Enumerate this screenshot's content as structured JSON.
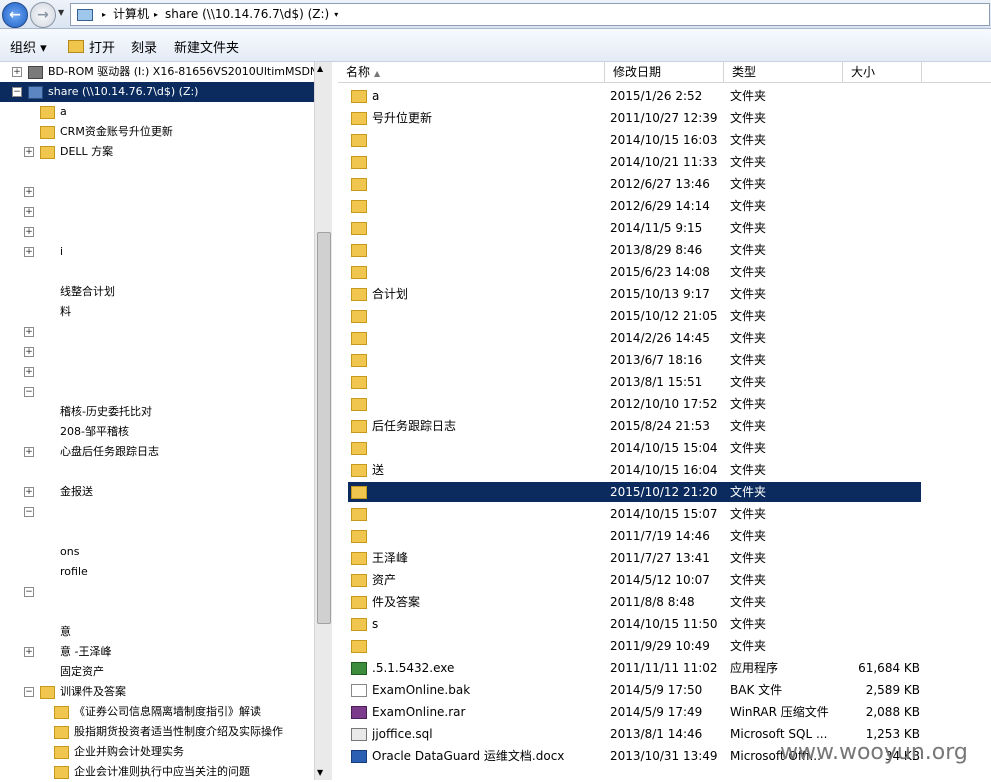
{
  "address": {
    "segments": [
      "计算机",
      "share (\\\\10.14.76.7\\d$) (Z:)"
    ]
  },
  "toolbar": {
    "organize": "组织 ▾",
    "open": "打开",
    "burn": "刻录",
    "new_folder": "新建文件夹"
  },
  "tree": [
    {
      "label": "BD-ROM 驱动器 (I:) X16-81656VS2010UltimMSDNCl",
      "expander": "+",
      "icon": "drive-icon"
    },
    {
      "label": "share (\\\\10.14.76.7\\d$) (Z:)",
      "expander": "-",
      "icon": "network-drive-icon",
      "selected": true
    },
    {
      "label": "a",
      "expander": "",
      "icon": "folder-icon"
    },
    {
      "label": "CRM资金账号升位更新",
      "expander": "",
      "icon": "folder-icon"
    },
    {
      "label": "DELL 方案",
      "expander": "+",
      "icon": "folder-icon"
    },
    {
      "label": "",
      "expander": "",
      "icon": ""
    },
    {
      "label": "",
      "expander": "+",
      "icon": ""
    },
    {
      "label": "",
      "expander": "+",
      "icon": ""
    },
    {
      "label": "",
      "expander": "+",
      "icon": ""
    },
    {
      "label": "i",
      "expander": "+",
      "icon": ""
    },
    {
      "label": "",
      "expander": "",
      "icon": ""
    },
    {
      "label": "线整合计划",
      "expander": "",
      "icon": ""
    },
    {
      "label": "料",
      "expander": "",
      "icon": ""
    },
    {
      "label": "",
      "expander": "+",
      "icon": ""
    },
    {
      "label": "",
      "expander": "+",
      "icon": ""
    },
    {
      "label": "",
      "expander": "+",
      "icon": ""
    },
    {
      "label": "",
      "expander": "-",
      "icon": ""
    },
    {
      "label": "稽核-历史委托比对",
      "expander": "",
      "icon": ""
    },
    {
      "label": "208-邹平稽核",
      "expander": "",
      "icon": ""
    },
    {
      "label": "心盘后任务跟踪日志",
      "expander": "+",
      "icon": ""
    },
    {
      "label": "",
      "expander": "",
      "icon": ""
    },
    {
      "label": "金报送",
      "expander": "+",
      "icon": ""
    },
    {
      "label": "",
      "expander": "-",
      "icon": ""
    },
    {
      "label": "",
      "expander": "",
      "icon": ""
    },
    {
      "label": "ons",
      "expander": "",
      "icon": ""
    },
    {
      "label": "rofile",
      "expander": "",
      "icon": ""
    },
    {
      "label": "",
      "expander": "-",
      "icon": ""
    },
    {
      "label": "",
      "expander": "",
      "icon": ""
    },
    {
      "label": "意",
      "expander": "",
      "icon": ""
    },
    {
      "label": "意 -王泽峰",
      "expander": "+",
      "icon": ""
    },
    {
      "label": "固定资产",
      "expander": "",
      "icon": ""
    },
    {
      "label": "训课件及答案",
      "expander": "-",
      "icon": "folder-icon"
    },
    {
      "label": "《证券公司信息隔离墙制度指引》解读",
      "expander": "",
      "icon": "folder-icon"
    },
    {
      "label": "股指期货投资者适当性制度介绍及实际操作",
      "expander": "",
      "icon": "folder-icon"
    },
    {
      "label": "企业并购会计处理实务",
      "expander": "",
      "icon": "folder-icon"
    },
    {
      "label": "企业会计准则执行中应当关注的问题",
      "expander": "",
      "icon": "folder-icon"
    }
  ],
  "columns": {
    "name": "名称",
    "date": "修改日期",
    "type": "类型",
    "size": "大小"
  },
  "files": [
    {
      "name": "a",
      "date": "2015/1/26 2:52",
      "type": "文件夹",
      "size": "",
      "icon": "folder-icon"
    },
    {
      "name": "号升位更新",
      "date": "2011/10/27 12:39",
      "type": "文件夹",
      "size": "",
      "icon": "folder-icon"
    },
    {
      "name": "",
      "date": "2014/10/15 16:03",
      "type": "文件夹",
      "size": "",
      "icon": "folder-icon"
    },
    {
      "name": "",
      "date": "2014/10/21 11:33",
      "type": "文件夹",
      "size": "",
      "icon": "folder-icon"
    },
    {
      "name": "",
      "date": "2012/6/27 13:46",
      "type": "文件夹",
      "size": "",
      "icon": "folder-icon"
    },
    {
      "name": "",
      "date": "2012/6/29 14:14",
      "type": "文件夹",
      "size": "",
      "icon": "folder-icon"
    },
    {
      "name": "",
      "date": "2014/11/5 9:15",
      "type": "文件夹",
      "size": "",
      "icon": "folder-icon"
    },
    {
      "name": "",
      "date": "2013/8/29 8:46",
      "type": "文件夹",
      "size": "",
      "icon": "folder-icon"
    },
    {
      "name": "",
      "date": "2015/6/23 14:08",
      "type": "文件夹",
      "size": "",
      "icon": "folder-icon"
    },
    {
      "name": "合计划",
      "date": "2015/10/13 9:17",
      "type": "文件夹",
      "size": "",
      "icon": "folder-icon"
    },
    {
      "name": "",
      "date": "2015/10/12 21:05",
      "type": "文件夹",
      "size": "",
      "icon": "folder-icon"
    },
    {
      "name": "",
      "date": "2014/2/26 14:45",
      "type": "文件夹",
      "size": "",
      "icon": "folder-icon"
    },
    {
      "name": "",
      "date": "2013/6/7 18:16",
      "type": "文件夹",
      "size": "",
      "icon": "folder-icon"
    },
    {
      "name": "",
      "date": "2013/8/1 15:51",
      "type": "文件夹",
      "size": "",
      "icon": "folder-icon"
    },
    {
      "name": "",
      "date": "2012/10/10 17:52",
      "type": "文件夹",
      "size": "",
      "icon": "folder-icon"
    },
    {
      "name": "后任务跟踪日志",
      "date": "2015/8/24 21:53",
      "type": "文件夹",
      "size": "",
      "icon": "folder-icon"
    },
    {
      "name": "",
      "date": "2014/10/15 15:04",
      "type": "文件夹",
      "size": "",
      "icon": "folder-icon"
    },
    {
      "name": "送",
      "date": "2014/10/15 16:04",
      "type": "文件夹",
      "size": "",
      "icon": "folder-icon"
    },
    {
      "name": "",
      "date": "2015/10/12 21:20",
      "type": "文件夹",
      "size": "",
      "icon": "folder-icon",
      "selected": true
    },
    {
      "name": "",
      "date": "2014/10/15 15:07",
      "type": "文件夹",
      "size": "",
      "icon": "folder-icon"
    },
    {
      "name": "",
      "date": "2011/7/19 14:46",
      "type": "文件夹",
      "size": "",
      "icon": "folder-icon"
    },
    {
      "name": "王泽峰",
      "date": "2011/7/27 13:41",
      "type": "文件夹",
      "size": "",
      "icon": "folder-icon"
    },
    {
      "name": "资产",
      "date": "2014/5/12 10:07",
      "type": "文件夹",
      "size": "",
      "icon": "folder-icon"
    },
    {
      "name": "件及答案",
      "date": "2011/8/8 8:48",
      "type": "文件夹",
      "size": "",
      "icon": "folder-icon"
    },
    {
      "name": "s",
      "date": "2014/10/15 11:50",
      "type": "文件夹",
      "size": "",
      "icon": "folder-icon"
    },
    {
      "name": "",
      "date": "2011/9/29 10:49",
      "type": "文件夹",
      "size": "",
      "icon": "folder-icon"
    },
    {
      "name": ".5.1.5432.exe",
      "date": "2011/11/11 11:02",
      "type": "应用程序",
      "size": "61,684 KB",
      "icon": "exe-icon"
    },
    {
      "name": "ExamOnline.bak",
      "date": "2014/5/9 17:50",
      "type": "BAK 文件",
      "size": "2,589 KB",
      "icon": "bak-icon"
    },
    {
      "name": "ExamOnline.rar",
      "date": "2014/5/9 17:49",
      "type": "WinRAR 压缩文件",
      "size": "2,088 KB",
      "icon": "rar-icon"
    },
    {
      "name": "jjoffice.sql",
      "date": "2013/8/1 14:46",
      "type": "Microsoft SQL ...",
      "size": "1,253 KB",
      "icon": "sql-icon"
    },
    {
      "name": "Oracle DataGuard 运维文档.docx",
      "date": "2013/10/31 13:49",
      "type": "Microsoft Offi...",
      "size": "34 KB",
      "icon": "docx-icon"
    }
  ],
  "watermark": "www.wooyun.org"
}
